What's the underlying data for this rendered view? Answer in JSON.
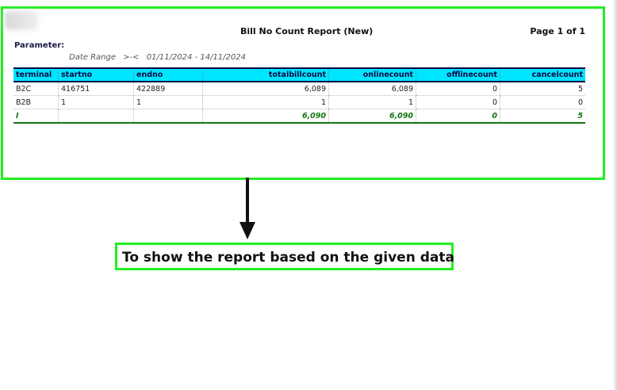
{
  "report": {
    "title": "Bill No Count Report (New)",
    "page_label": "Page 1 of 1",
    "parameter_heading": "Parameter:",
    "date_range_label": "Date Range",
    "date_range_sep": ">-<",
    "date_range_value": "01/11/2024 - 14/11/2024",
    "columns": [
      "terminal",
      "startno",
      "endno",
      "totalbillcount",
      "onlinecount",
      "offlinecount",
      "cancelcount"
    ],
    "rows": [
      [
        "B2C",
        "416751",
        "422889",
        "6,089",
        "6,089",
        "0",
        "5"
      ],
      [
        "B2B",
        "1",
        "1",
        "1",
        "1",
        "0",
        "0"
      ]
    ],
    "total_row": [
      "I",
      "",
      "",
      "6,090",
      "6,090",
      "0",
      "5"
    ]
  },
  "annotation": {
    "text": "To show the report based on the given data",
    "highlight_color": "#22ee22"
  }
}
